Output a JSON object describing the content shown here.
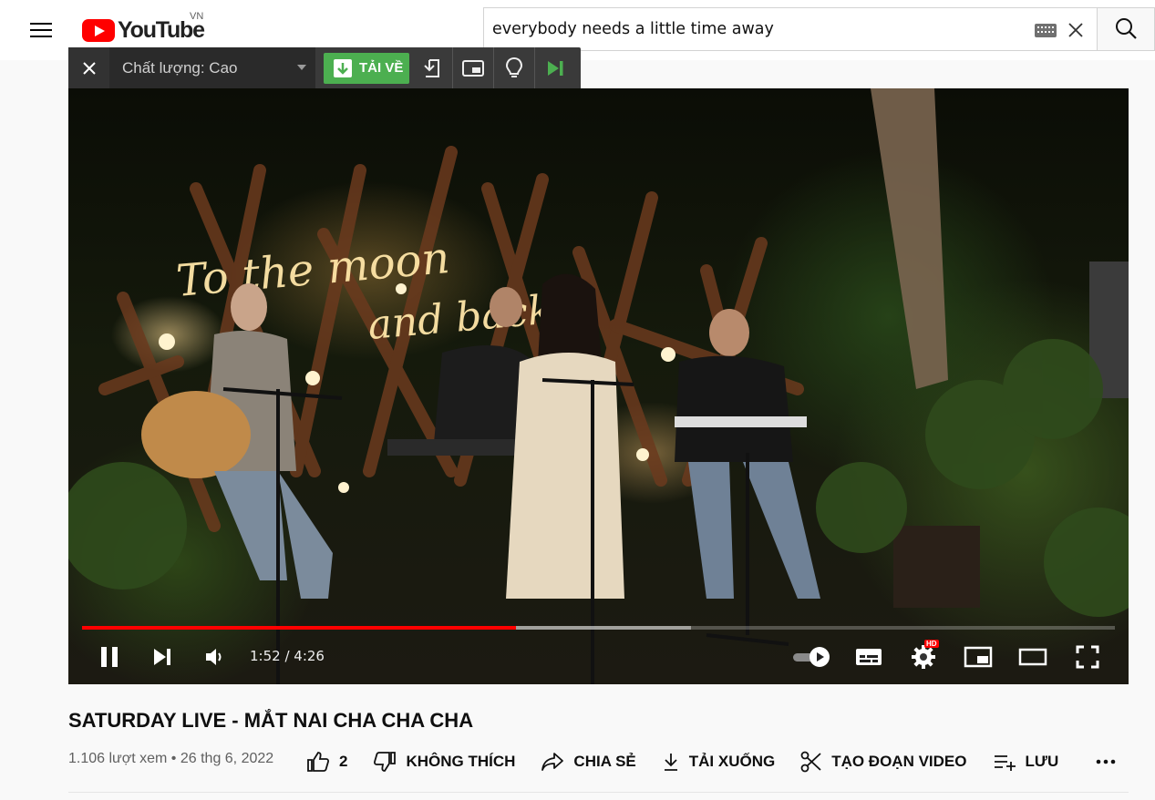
{
  "masthead": {
    "logo_text": "YouTube",
    "country_code": "VN",
    "search_query": "everybody needs a little time away"
  },
  "download_toolbar": {
    "quality_label": "Chất lượng: Cao",
    "download_label": "TẢI VỀ",
    "accent_color": "#4caf50"
  },
  "player": {
    "time_current": "1:52",
    "time_total": "4:26",
    "time_display": "1:52 / 4:26",
    "played_fraction": 0.42,
    "loaded_fraction": 0.59,
    "hd_badge": "HD",
    "progress_color": "#ff0000"
  },
  "video": {
    "title": "SATURDAY LIVE - MẮT NAI CHA CHA CHA",
    "views_and_date": "1.106 lượt xem • 26 thg 6, 2022"
  },
  "actions": {
    "like_count": "2",
    "dislike_label": "KHÔNG THÍCH",
    "share_label": "CHIA SẺ",
    "download_label": "TẢI XUỐNG",
    "clip_label": "TẠO ĐOẠN VIDEO",
    "save_label": "LƯU"
  }
}
